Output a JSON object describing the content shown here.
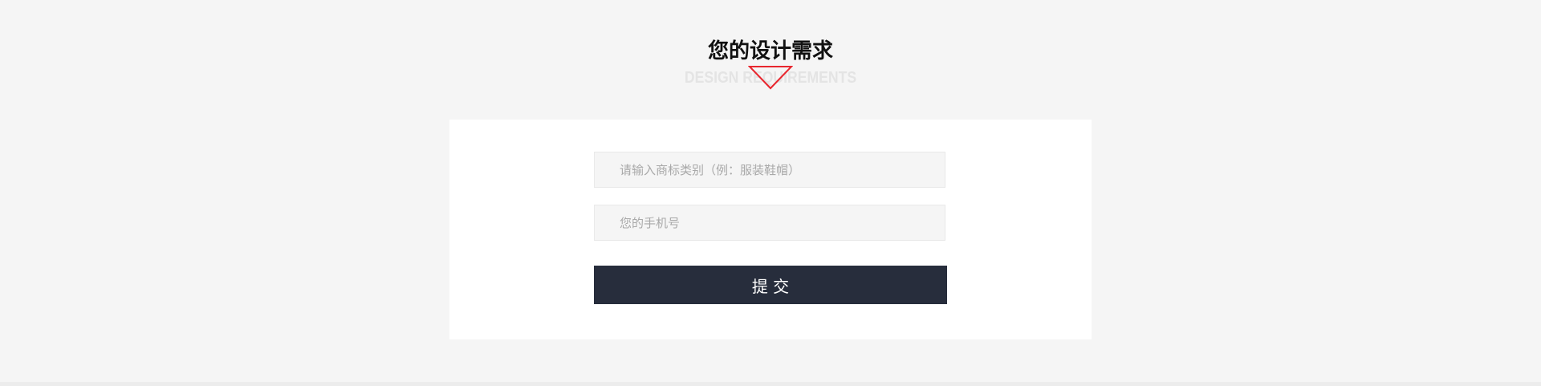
{
  "heading": {
    "title_cn": "您的设计需求",
    "title_en": "DESIGN REQUIREMENTS"
  },
  "form": {
    "category_placeholder": "请输入商标类别（例：服装鞋帽）",
    "phone_placeholder": "您的手机号",
    "submit_label": "提 交"
  },
  "colors": {
    "page_background": "#f5f5f5",
    "card_background": "#ffffff",
    "button_background": "#272d3c",
    "accent_triangle": "#e8262e"
  }
}
